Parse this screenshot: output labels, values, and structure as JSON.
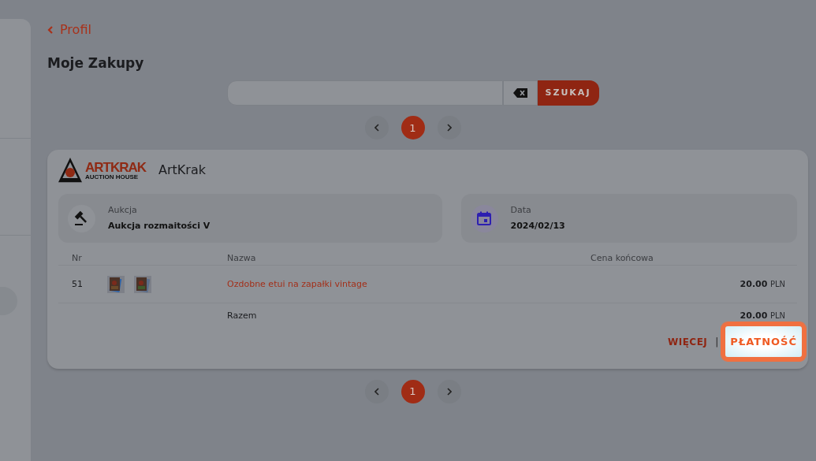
{
  "back_link": {
    "label": "Profil"
  },
  "page_title": "Moje Zakupy",
  "search": {
    "button": "SZUKAJ"
  },
  "pagination_top": {
    "pages": [
      {
        "label": "1",
        "selected": true
      }
    ]
  },
  "purchase": {
    "seller": "ArtKrak",
    "logo": {
      "title": "ARTKRAK",
      "subtitle": "AUCTION HOUSE"
    },
    "info": [
      {
        "kind": "auction",
        "label": "Aukcja",
        "value": "Aukcja rozmaitości V"
      },
      {
        "kind": "date",
        "label": "Data",
        "value": "2024/02/13"
      }
    ],
    "table": {
      "columns": [
        "Nr",
        "Nazwa",
        "Cena końcowa"
      ],
      "rows": [
        {
          "nr": "51",
          "name": "Ozdobne etui na zapałki vintage",
          "amount": "20.00",
          "currency": "PLN"
        }
      ],
      "total": {
        "label": "Razem",
        "amount": "20.00",
        "currency": "PLN"
      }
    },
    "actions": [
      {
        "label": "WIĘCEJ",
        "highlighted": false
      },
      {
        "label": "PŁATNOŚĆ",
        "highlighted": true
      }
    ],
    "separator": "|"
  },
  "pagination_bottom": {
    "pages": [
      {
        "label": "1",
        "selected": true
      }
    ]
  }
}
